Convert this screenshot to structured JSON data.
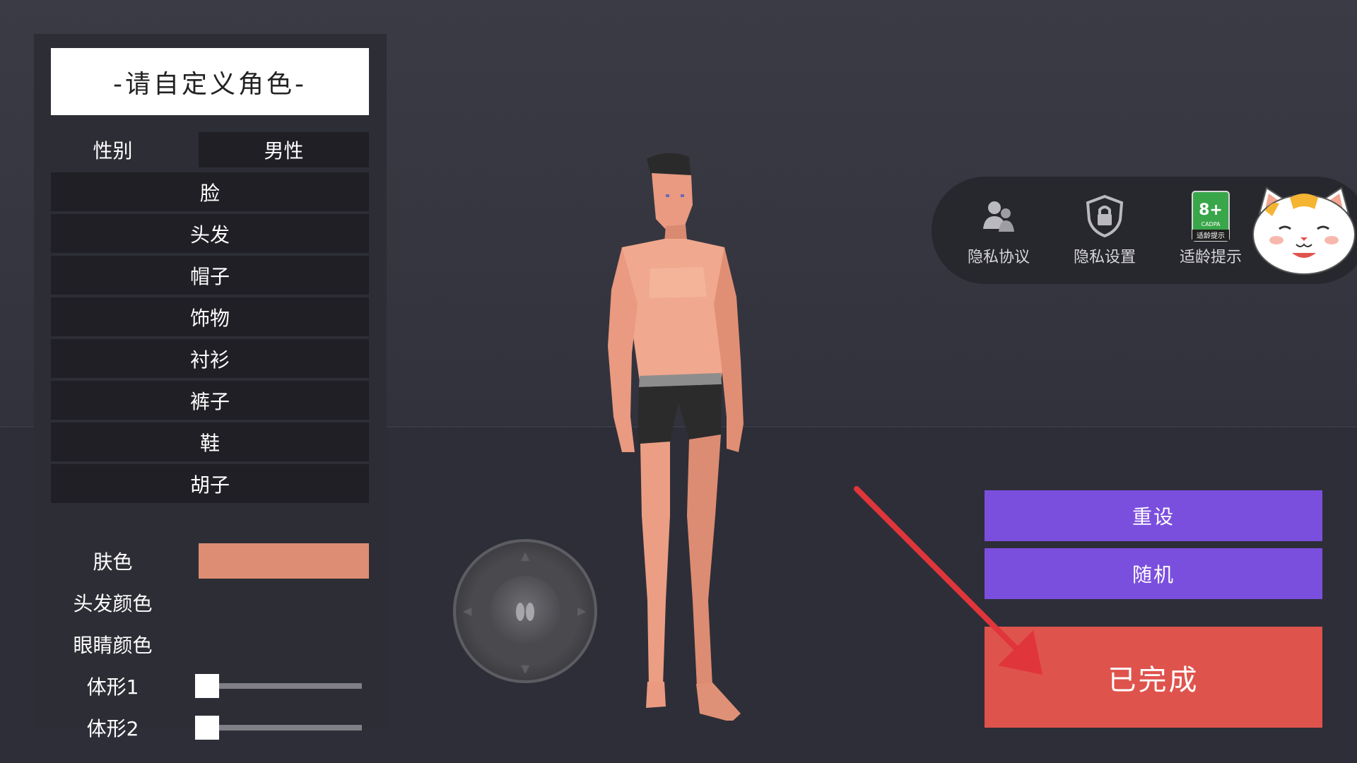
{
  "panel": {
    "title": "-请自定义角色-",
    "gender_label": "性别",
    "gender_value": "男性",
    "menu_items": [
      "脸",
      "头发",
      "帽子",
      "饰物",
      "衬衫",
      "裤子",
      "鞋",
      "胡子"
    ],
    "skin_label": "肤色",
    "skin_color": "#dd8d74",
    "hair_color_label": "头发颜色",
    "eye_color_label": "眼睛颜色",
    "body_shape_1_label": "体形1",
    "body_shape_2_label": "体形2",
    "body_shape_1_value": 0,
    "body_shape_2_value": 0
  },
  "info_bar": {
    "privacy_agreement": "隐私协议",
    "privacy_settings": "隐私设置",
    "age_rating": "适龄提示",
    "age_badge_number": "8+",
    "age_badge_org": "CADPA",
    "age_badge_text": "适龄提示"
  },
  "buttons": {
    "reset": "重设",
    "random": "随机",
    "done": "已完成"
  },
  "colors": {
    "purple_button": "#7b4fde",
    "done_button": "#df534d",
    "annotation_arrow": "#e0353a"
  }
}
